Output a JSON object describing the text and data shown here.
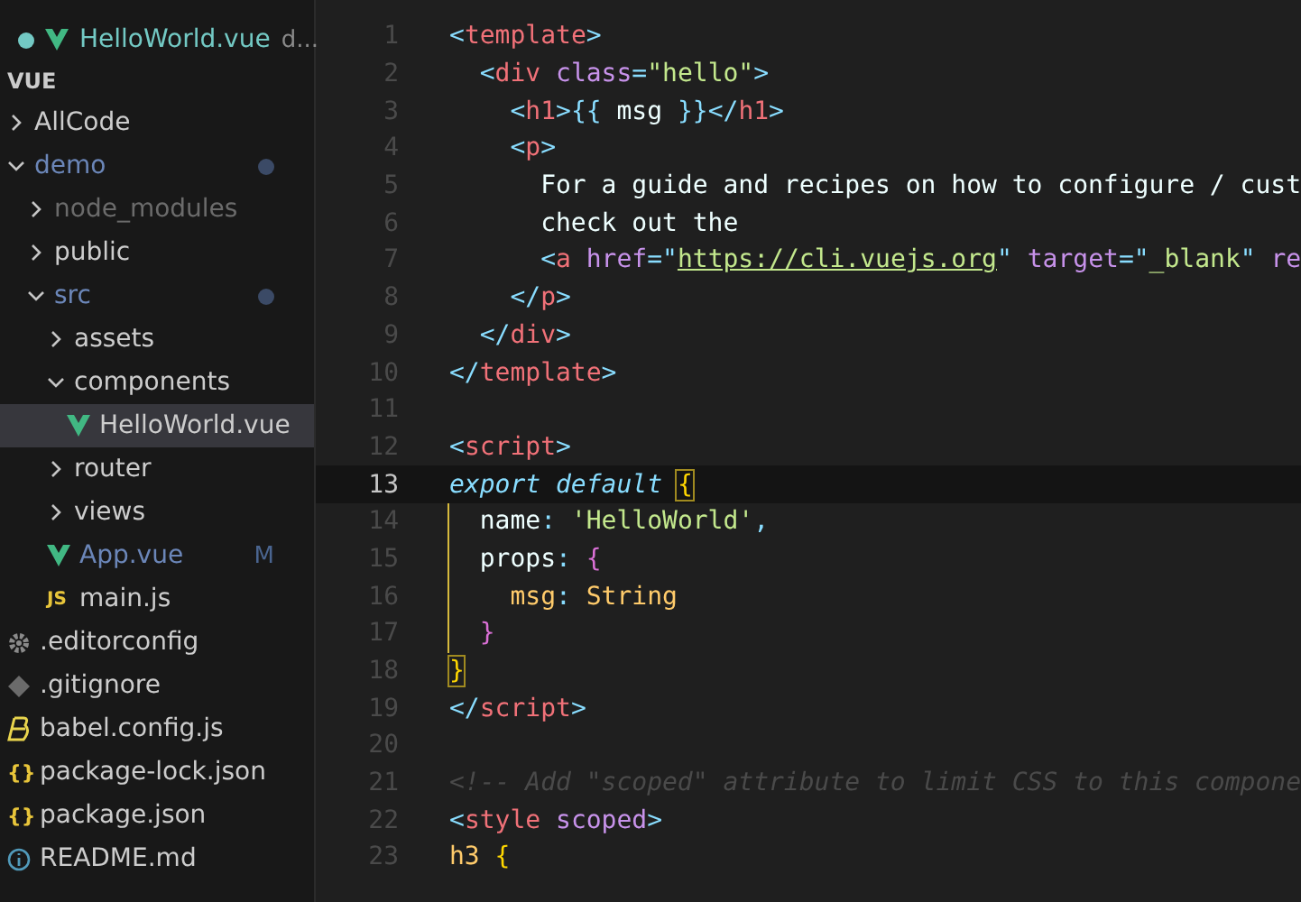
{
  "sidebar": {
    "open_editor": {
      "name": "HelloWorld.vue",
      "path": "d...",
      "unsaved": true
    },
    "section_title": "VUE",
    "tree": [
      {
        "label": "AllCode",
        "kind": "folder",
        "expanded": false
      },
      {
        "label": "demo",
        "kind": "folder",
        "expanded": true,
        "modified_dot": true,
        "children": [
          {
            "label": "node_modules",
            "kind": "folder",
            "expanded": false,
            "ignored": true
          },
          {
            "label": "public",
            "kind": "folder",
            "expanded": false
          },
          {
            "label": "src",
            "kind": "folder",
            "expanded": true,
            "modified_dot": true,
            "children": [
              {
                "label": "assets",
                "kind": "folder",
                "expanded": false
              },
              {
                "label": "components",
                "kind": "folder",
                "expanded": true,
                "children": [
                  {
                    "label": "HelloWorld.vue",
                    "kind": "vue",
                    "selected": true
                  }
                ]
              },
              {
                "label": "router",
                "kind": "folder",
                "expanded": false
              },
              {
                "label": "views",
                "kind": "folder",
                "expanded": false
              },
              {
                "label": "App.vue",
                "kind": "vue",
                "badge": "M",
                "selected": false
              },
              {
                "label": "main.js",
                "kind": "js",
                "icon_text": "JS",
                "selected": false
              }
            ]
          }
        ]
      },
      {
        "label": ".editorconfig",
        "kind": "gear",
        "selected": false
      },
      {
        "label": ".gitignore",
        "kind": "git",
        "selected": false
      },
      {
        "label": "babel.config.js",
        "kind": "babel",
        "selected": false
      },
      {
        "label": "package-lock.json",
        "kind": "json",
        "icon_text": "{}",
        "selected": false
      },
      {
        "label": "package.json",
        "kind": "json",
        "icon_text": "{}",
        "selected": false
      },
      {
        "label": "README.md",
        "kind": "info",
        "selected": false
      }
    ]
  },
  "editor": {
    "lines": [
      {
        "number": "1",
        "current": false,
        "tokens": [
          {
            "text": "<",
            "kind": "punct"
          },
          {
            "text": "template",
            "kind": "tag"
          },
          {
            "text": ">",
            "kind": "punct"
          }
        ]
      },
      {
        "number": "2",
        "current": false,
        "tokens": [
          {
            "text": "  <",
            "kind": "punct"
          },
          {
            "text": "div",
            "kind": "tag"
          },
          {
            "text": " class",
            "kind": "attr"
          },
          {
            "text": "=",
            "kind": "op"
          },
          {
            "text": "\"hello\"",
            "kind": "string"
          },
          {
            "text": ">",
            "kind": "punct"
          }
        ]
      },
      {
        "number": "3",
        "current": false,
        "tokens": [
          {
            "text": "    <",
            "kind": "punct"
          },
          {
            "text": "h1",
            "kind": "tag"
          },
          {
            "text": ">{{",
            "kind": "punct"
          },
          {
            "text": " msg ",
            "kind": "plain"
          },
          {
            "text": "}}</",
            "kind": "punct"
          },
          {
            "text": "h1",
            "kind": "tag"
          },
          {
            "text": ">",
            "kind": "punct"
          }
        ]
      },
      {
        "number": "4",
        "current": false,
        "tokens": [
          {
            "text": "    <",
            "kind": "punct"
          },
          {
            "text": "p",
            "kind": "tag"
          },
          {
            "text": ">",
            "kind": "punct"
          }
        ]
      },
      {
        "number": "5",
        "current": false,
        "tokens": [
          {
            "text": "      For a guide and recipes on how to configure / cust",
            "kind": "plain"
          }
        ]
      },
      {
        "number": "6",
        "current": false,
        "tokens": [
          {
            "text": "      check out the",
            "kind": "plain"
          }
        ]
      },
      {
        "number": "7",
        "current": false,
        "tokens": [
          {
            "text": "      <",
            "kind": "punct"
          },
          {
            "text": "a",
            "kind": "tag"
          },
          {
            "text": " href",
            "kind": "attr"
          },
          {
            "text": "=\"",
            "kind": "op"
          },
          {
            "text": "https://cli.vuejs.org",
            "kind": "link"
          },
          {
            "text": "\"",
            "kind": "op"
          },
          {
            "text": " target",
            "kind": "attr"
          },
          {
            "text": "=\"",
            "kind": "op"
          },
          {
            "text": "_blank",
            "kind": "string"
          },
          {
            "text": "\"",
            "kind": "op"
          },
          {
            "text": " re",
            "kind": "attr"
          }
        ]
      },
      {
        "number": "8",
        "current": false,
        "tokens": [
          {
            "text": "    </",
            "kind": "punct"
          },
          {
            "text": "p",
            "kind": "tag"
          },
          {
            "text": ">",
            "kind": "punct"
          }
        ]
      },
      {
        "number": "9",
        "current": false,
        "tokens": [
          {
            "text": "  </",
            "kind": "punct"
          },
          {
            "text": "div",
            "kind": "tag"
          },
          {
            "text": ">",
            "kind": "punct"
          }
        ]
      },
      {
        "number": "10",
        "current": false,
        "tokens": [
          {
            "text": "</",
            "kind": "punct"
          },
          {
            "text": "template",
            "kind": "tag"
          },
          {
            "text": ">",
            "kind": "punct"
          }
        ]
      },
      {
        "number": "11",
        "current": false
      },
      {
        "number": "12",
        "current": false,
        "tokens": [
          {
            "text": "<",
            "kind": "punct"
          },
          {
            "text": "script",
            "kind": "tag"
          },
          {
            "text": ">",
            "kind": "punct"
          }
        ]
      },
      {
        "number": "13",
        "current": true,
        "tokens": [
          {
            "text": "export default ",
            "kind": "keyword"
          },
          {
            "text": "{",
            "kind": "brace-match"
          }
        ]
      },
      {
        "number": "14",
        "current": false,
        "bracket_guide": true,
        "tokens": [
          {
            "text": "  name",
            "kind": "plain"
          },
          {
            "text": ": ",
            "kind": "op"
          },
          {
            "text": "'HelloWorld'",
            "kind": "string"
          },
          {
            "text": ",",
            "kind": "op"
          }
        ]
      },
      {
        "number": "15",
        "current": false,
        "bracket_guide": true,
        "tokens": [
          {
            "text": "  props",
            "kind": "plain"
          },
          {
            "text": ": ",
            "kind": "op"
          },
          {
            "text": "{",
            "kind": "brace2"
          }
        ]
      },
      {
        "number": "16",
        "current": false,
        "bracket_guide": true,
        "tokens": [
          {
            "text": "    msg",
            "kind": "type"
          },
          {
            "text": ": ",
            "kind": "op"
          },
          {
            "text": "String",
            "kind": "type"
          }
        ]
      },
      {
        "number": "17",
        "current": false,
        "bracket_guide": true,
        "tokens": [
          {
            "text": "  }",
            "kind": "brace2"
          }
        ]
      },
      {
        "number": "18",
        "current": false,
        "tokens": [
          {
            "text": "}",
            "kind": "brace-match"
          }
        ]
      },
      {
        "number": "19",
        "current": false,
        "tokens": [
          {
            "text": "</",
            "kind": "punct"
          },
          {
            "text": "script",
            "kind": "tag"
          },
          {
            "text": ">",
            "kind": "punct"
          }
        ]
      },
      {
        "number": "20",
        "current": false
      },
      {
        "number": "21",
        "current": false,
        "tokens": [
          {
            "text": "<!-- Add \"scoped\" attribute to limit CSS to this compone",
            "kind": "comment"
          }
        ]
      },
      {
        "number": "22",
        "current": false,
        "tokens": [
          {
            "text": "<",
            "kind": "punct"
          },
          {
            "text": "style",
            "kind": "tag"
          },
          {
            "text": " scoped",
            "kind": "attr"
          },
          {
            "text": ">",
            "kind": "punct"
          }
        ]
      },
      {
        "number": "23",
        "current": false,
        "tokens": [
          {
            "text": "h3 ",
            "kind": "type"
          },
          {
            "text": "{",
            "kind": "brace"
          }
        ]
      }
    ]
  }
}
